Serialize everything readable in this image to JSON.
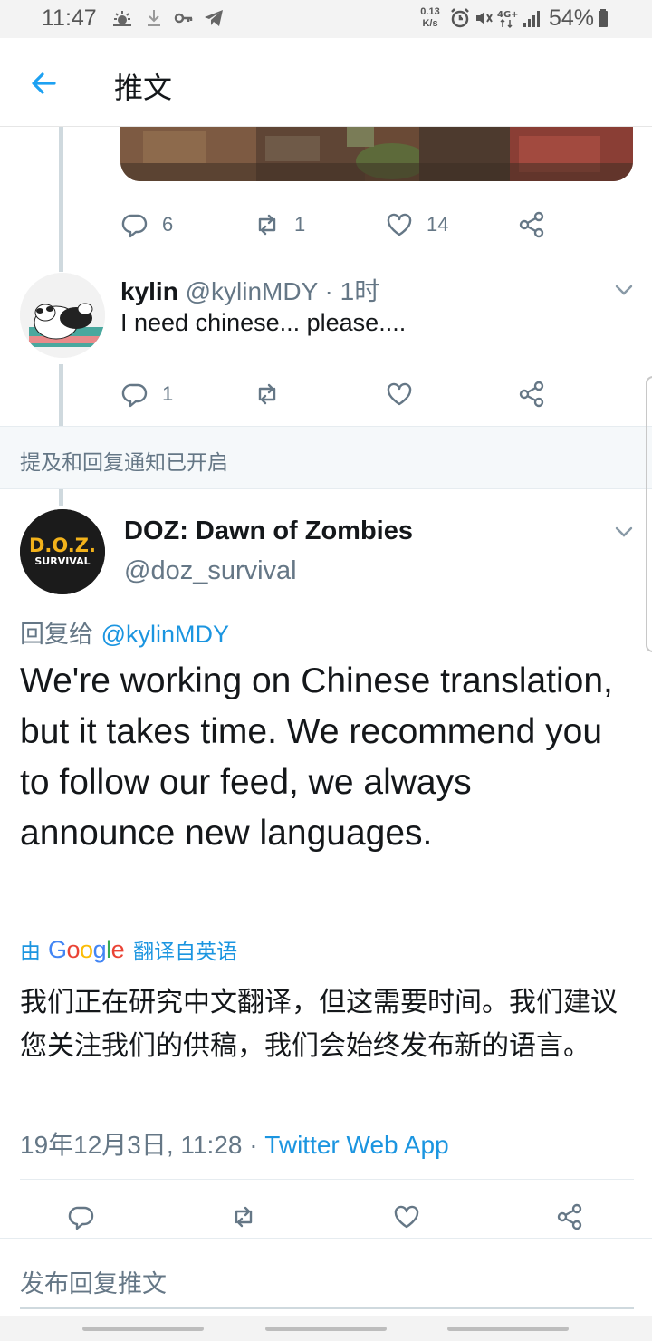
{
  "status_bar": {
    "time": "11:47",
    "net_speed_value": "0.13",
    "net_speed_unit": "K/s",
    "battery": "54%"
  },
  "app_bar": {
    "title": "推文"
  },
  "prev_tweet": {
    "reply_count": "6",
    "retweet_count": "1",
    "like_count": "14"
  },
  "kylin_tweet": {
    "name": "kylin",
    "handle": "@kylinMDY",
    "time": " · 1时",
    "text": "I need chinese... please....",
    "reply_count": "1",
    "retweet_count": "",
    "like_count": ""
  },
  "notice": "提及和回复通知已开启",
  "main_tweet": {
    "name": "DOZ: Dawn of Zombies",
    "handle": "@doz_survival",
    "avatar_line1": "D.O.Z.",
    "avatar_line2": "SURVIVAL",
    "reply_prefix": "回复给 ",
    "reply_handle": "@kylinMDY",
    "text": "We're working on Chinese translation, but it takes time. We recommend you to follow our feed, we always announce new languages.",
    "translated_prefix": "由",
    "translated_suffix": "翻译自英语",
    "google_letters": [
      "G",
      "o",
      "o",
      "g",
      "l",
      "e"
    ],
    "translation": "我们正在研究中文翻译，但这需要时间。我们建议您关注我们的供稿，我们会始终发布新的语言。",
    "timestamp": "19年12月3日, 11:28 · ",
    "source_app": "Twitter Web App"
  },
  "compose": {
    "placeholder": "发布回复推文"
  },
  "colors": {
    "accent": "#1b95e0",
    "secondary_text": "#657786",
    "primary_text": "#14171a",
    "thread_line": "#cfd9de"
  }
}
